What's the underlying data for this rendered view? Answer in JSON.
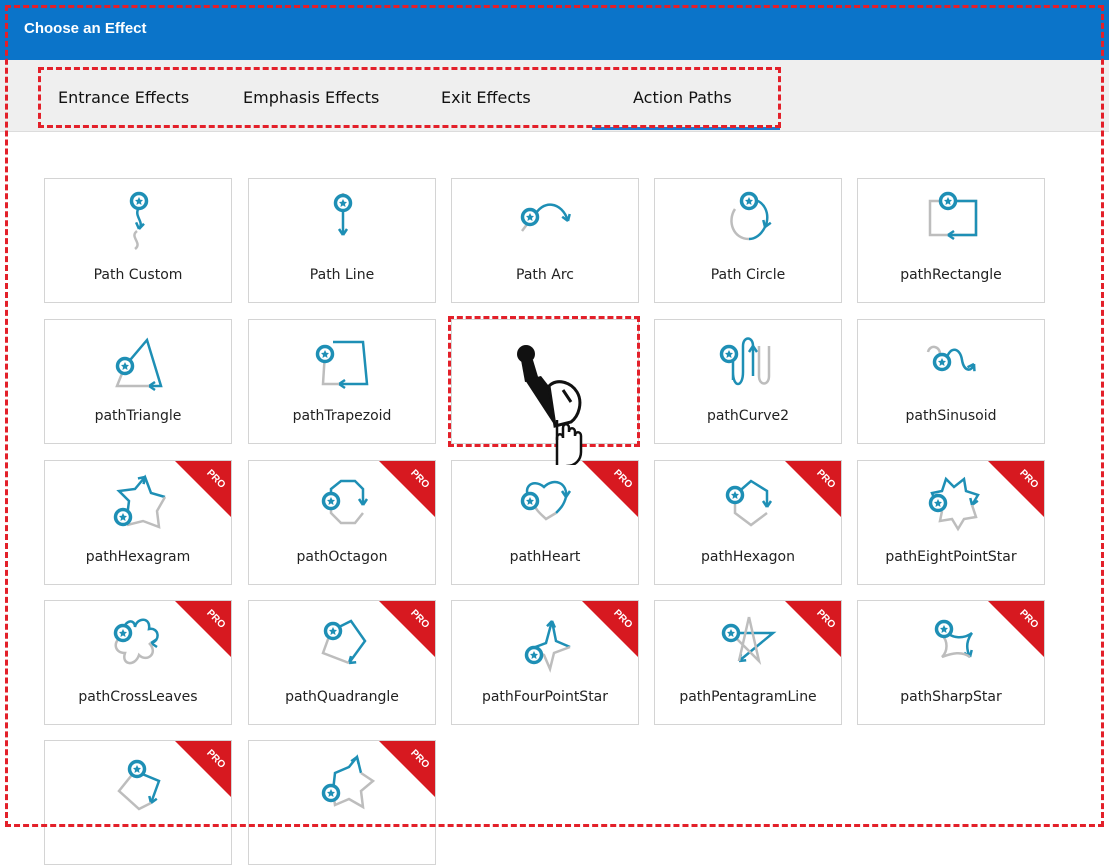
{
  "window": {
    "title": "Choose an Effect"
  },
  "tabs": [
    {
      "label": "Entrance Effects"
    },
    {
      "label": "Emphasis Effects"
    },
    {
      "label": "Exit Effects"
    },
    {
      "label": "Action Paths",
      "selected": true
    }
  ],
  "effects": [
    {
      "label": "Path Custom",
      "icon": "path-custom-icon",
      "pro": false
    },
    {
      "label": "Path Line",
      "icon": "path-line-icon",
      "pro": false
    },
    {
      "label": "Path Arc",
      "icon": "path-arc-icon",
      "pro": false
    },
    {
      "label": "Path Circle",
      "icon": "path-circle-icon",
      "pro": false
    },
    {
      "label": "pathRectangle",
      "icon": "path-rectangle-icon",
      "pro": false
    },
    {
      "label": "pathTriangle",
      "icon": "path-triangle-icon",
      "pro": false
    },
    {
      "label": "pathTrapezoid",
      "icon": "path-trapezoid-icon",
      "pro": false
    },
    {
      "label": "",
      "icon": "mouse-draw-icon",
      "pro": false,
      "selected": true
    },
    {
      "label": "pathCurve2",
      "icon": "path-curve2-icon",
      "pro": false
    },
    {
      "label": "pathSinusoid",
      "icon": "path-sinusoid-icon",
      "pro": false
    },
    {
      "label": "pathHexagram",
      "icon": "path-hexagram-icon",
      "pro": true
    },
    {
      "label": "pathOctagon",
      "icon": "path-octagon-icon",
      "pro": true
    },
    {
      "label": "pathHeart",
      "icon": "path-heart-icon",
      "pro": true
    },
    {
      "label": "pathHexagon",
      "icon": "path-hexagon-icon",
      "pro": true
    },
    {
      "label": "pathEightPointStar",
      "icon": "path-eight-point-star-icon",
      "pro": true
    },
    {
      "label": "pathCrossLeaves",
      "icon": "path-cross-leaves-icon",
      "pro": true
    },
    {
      "label": "pathQuadrangle",
      "icon": "path-quadrangle-icon",
      "pro": true
    },
    {
      "label": "pathFourPointStar",
      "icon": "path-four-point-star-icon",
      "pro": true
    },
    {
      "label": "pathPentagramLine",
      "icon": "path-pentagram-line-icon",
      "pro": true
    },
    {
      "label": "pathSharpStar",
      "icon": "path-sharp-star-icon",
      "pro": true
    },
    {
      "label": "",
      "icon": "path-pentagon-icon",
      "pro": true
    },
    {
      "label": "",
      "icon": "path-star-icon",
      "pro": true
    }
  ],
  "badge": {
    "text": "PRO",
    "color": "#d71920"
  },
  "colors": {
    "accent": "#0b74c9",
    "icon": "#1e8fb5",
    "dash": "#e3202a"
  }
}
